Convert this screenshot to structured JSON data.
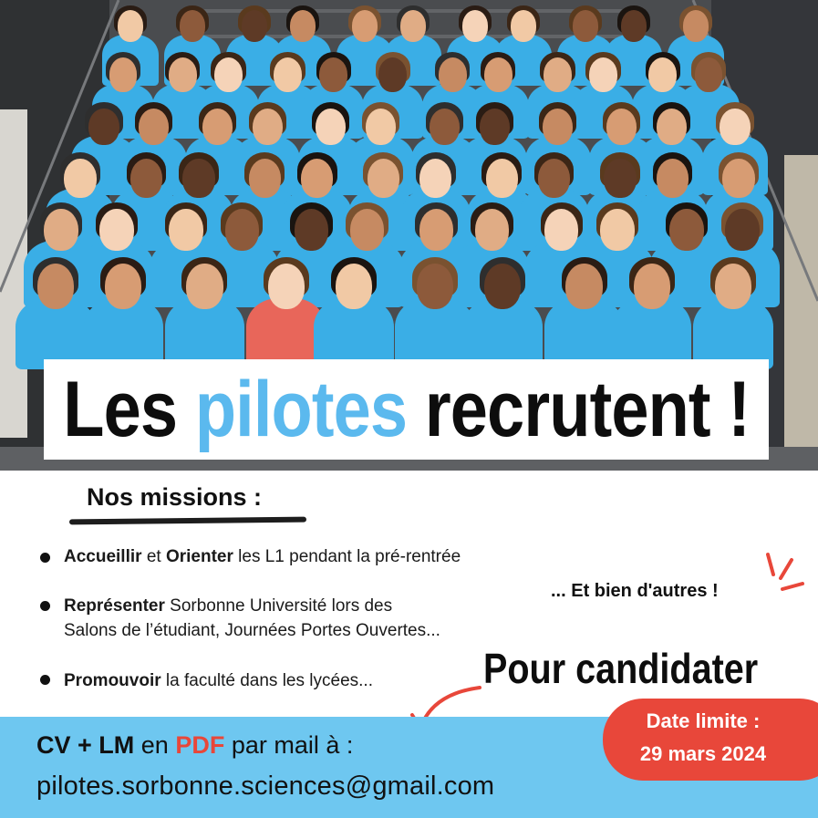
{
  "title": {
    "part1": "Les ",
    "accent": "pilotes",
    "part2": " recrutent !"
  },
  "missions": {
    "heading": "Nos missions :",
    "items": [
      {
        "bold1": "Accueillir",
        "text1": " et ",
        "bold2": "Orienter",
        "text2": " les L1 pendant la pré-rentrée"
      },
      {
        "bold1": "Représenter",
        "text1": " Sorbonne Université lors des",
        "line2": "Salons de l’étudiant, Journées Portes Ouvertes..."
      },
      {
        "bold1": "Promouvoir",
        "text1": " la faculté dans les lycées..."
      }
    ],
    "others": "... Et bien d'autres !"
  },
  "apply": {
    "heading": "Pour candidater",
    "cv": "CV + LM",
    "en": " en ",
    "pdf": "PDF",
    "rest": " par mail à  :",
    "email": "pilotes.sorbonne.sciences@gmail.com"
  },
  "deadline": {
    "label": "Date limite :",
    "date": "29 mars 2024"
  },
  "colors": {
    "accent_blue": "#5bb9ee",
    "band_blue": "#6ec7f0",
    "deadline_red": "#e8473a",
    "shirt_blue": "#3aaee6"
  },
  "icons": {
    "bullet": "filled-circle",
    "sparks": "spark-lines-icon",
    "arrow": "curved-arrow-icon"
  }
}
